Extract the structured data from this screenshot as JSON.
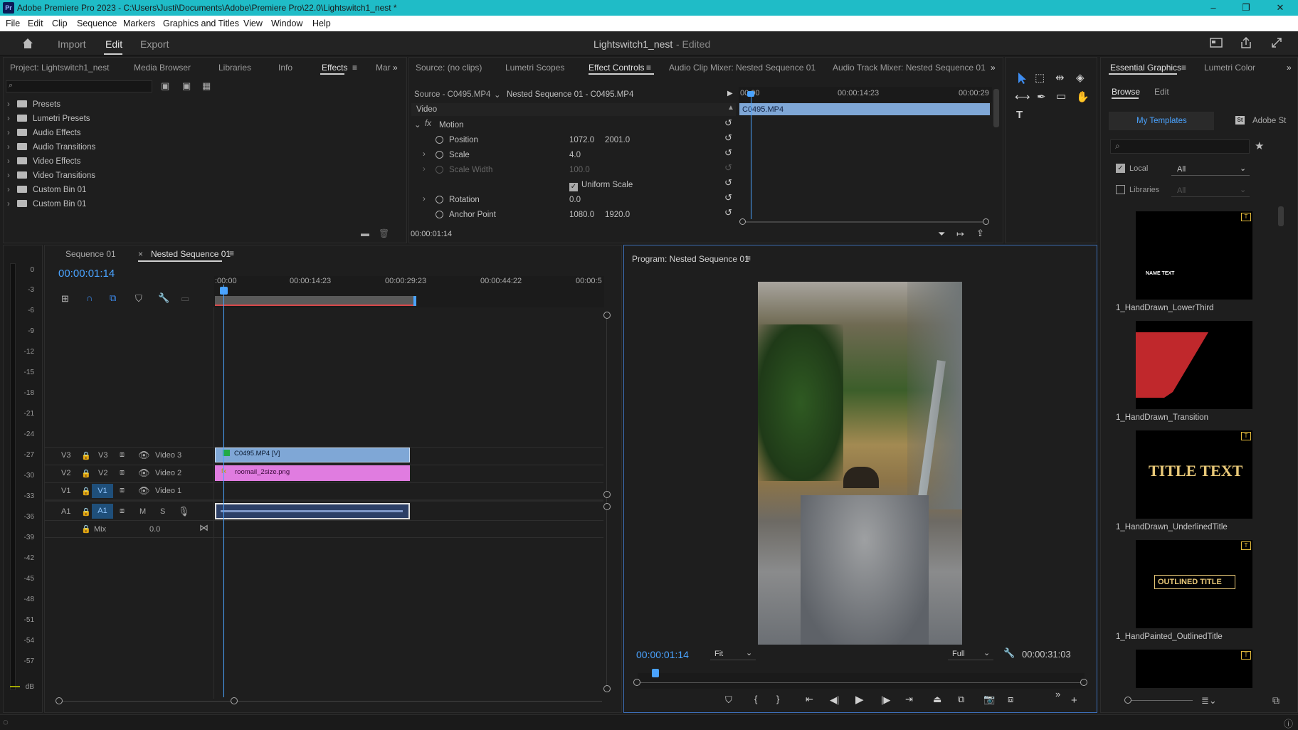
{
  "window": {
    "app_title": "Adobe Premiere Pro 2023 - C:\\Users\\Justi\\Documents\\Adobe\\Premiere Pro\\22.0\\Lightswitch1_nest *",
    "logo": "Pr",
    "min": "–",
    "max": "❐",
    "close": "✕"
  },
  "menu": [
    "File",
    "Edit",
    "Clip",
    "Sequence",
    "Markers",
    "Graphics and Titles",
    "View",
    "Window",
    "Help"
  ],
  "workspaces": {
    "import": "Import",
    "edit": "Edit",
    "export": "Export",
    "project_title": "Lightswitch1_nest",
    "edited": "- Edited"
  },
  "project_panel": {
    "tabs": [
      "Project: Lightswitch1_nest",
      "Media Browser",
      "Libraries",
      "Info",
      "Effects",
      "Mar"
    ],
    "search_placeholder": "",
    "items": [
      "Presets",
      "Lumetri Presets",
      "Audio Effects",
      "Audio Transitions",
      "Video Effects",
      "Video Transitions",
      "Custom Bin 01",
      "Custom Bin 01"
    ]
  },
  "effect_controls": {
    "tabs": [
      "Source: (no clips)",
      "Lumetri Scopes",
      "Effect Controls",
      "Audio Clip Mixer: Nested Sequence 01",
      "Audio Track Mixer: Nested Sequence 01"
    ],
    "source_label": "Source - C0495.MP4",
    "sequence_label": "Nested Sequence 01 - C0495.MP4",
    "section": "Video",
    "fx": "fx",
    "motion": "Motion",
    "props": [
      {
        "name": "Position",
        "v1": "1072.0",
        "v2": "2001.0"
      },
      {
        "name": "Scale",
        "v1": "4.0",
        "v2": ""
      },
      {
        "name": "Scale Width",
        "v1": "100.0",
        "v2": ""
      },
      {
        "name": "Uniform Scale",
        "v1": "",
        "v2": ""
      },
      {
        "name": "Rotation",
        "v1": "0.0",
        "v2": ""
      },
      {
        "name": "Anchor Point",
        "v1": "1080.0",
        "v2": "1920.0"
      }
    ],
    "ruler": [
      "00:00",
      "00:00:14:23",
      "00:00:29"
    ],
    "clip_name": "C0495.MP4",
    "timecode": "00:00:01:14"
  },
  "timeline": {
    "tabs": [
      "Sequence 01",
      "Nested Sequence 01"
    ],
    "timecode": "00:00:01:14",
    "ruler": [
      ":00:00",
      "00:00:14:23",
      "00:00:29:23",
      "00:00:44:22",
      "00:00:5"
    ],
    "tracks": [
      {
        "a": "V3",
        "b": "V3",
        "name": "Video 3"
      },
      {
        "a": "V2",
        "b": "V2",
        "name": "Video 2"
      },
      {
        "a": "V1",
        "b": "V1",
        "name": "Video 1"
      },
      {
        "a": "A1",
        "b": "A1",
        "name": ""
      }
    ],
    "mix_label": "Mix",
    "mix_value": "0.0",
    "clip_v3": "C0495.MP4 [V]",
    "clip_v2": "roomail_2size.png",
    "meter": [
      "0",
      "-3",
      "-6",
      "-9",
      "-12",
      "-15",
      "-18",
      "-21",
      "-24",
      "-27",
      "-30",
      "-33",
      "-36",
      "-39",
      "-42",
      "-45",
      "-48",
      "-51",
      "-54",
      "-57",
      "dB"
    ]
  },
  "program": {
    "title": "Program: Nested Sequence 01",
    "timecode": "00:00:01:14",
    "fit": "Fit",
    "quality": "Full",
    "duration": "00:00:31:03"
  },
  "essential_graphics": {
    "tabs": [
      "Essential Graphics",
      "Lumetri Color"
    ],
    "subtabs": [
      "Browse",
      "Edit"
    ],
    "my_templates": "My Templates",
    "adobe_stock": "Adobe St",
    "local": "Local",
    "libraries": "Libraries",
    "filter_all": "All",
    "filter_all2": "All",
    "templates": [
      {
        "label": "1_HandDrawn_LowerThird",
        "text": "NAME TEXT"
      },
      {
        "label": "1_HandDrawn_Transition",
        "text": ""
      },
      {
        "label": "1_HandDrawn_UnderlinedTitle",
        "text": "TITLE TEXT"
      },
      {
        "label": "1_HandPainted_OutlinedTitle",
        "text": "OUTLINED TITLE"
      }
    ]
  },
  "colors": {
    "accent": "#4aa3ff",
    "titlebar": "#1fbcc7",
    "clip_video": "#7fa7d6",
    "clip_graphic": "#e07ce0",
    "audio_clip": "#5a7bbf",
    "playhead": "#4aa3ff",
    "work_area": "#d9484a"
  }
}
